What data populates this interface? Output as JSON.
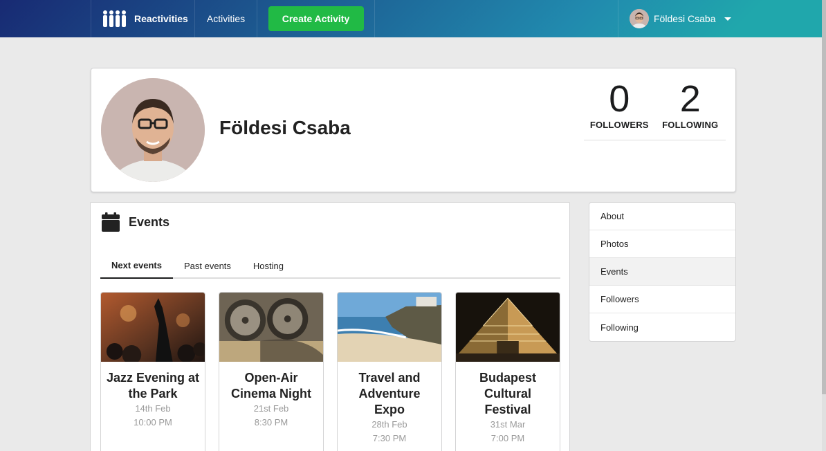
{
  "nav": {
    "brand": "Reactivities",
    "activities": "Activities",
    "create": "Create Activity",
    "user_name": "Földesi Csaba",
    "brand_icon": "people-group-icon",
    "caret_icon": "caret-down-icon"
  },
  "profile": {
    "name": "Földesi Csaba",
    "followers_count": "0",
    "followers_label": "FOLLOWERS",
    "following_count": "2",
    "following_label": "FOLLOWING"
  },
  "events": {
    "title": "Events",
    "icon": "calendar-icon",
    "tabs": [
      {
        "label": "Next events",
        "active": true
      },
      {
        "label": "Past events",
        "active": false
      },
      {
        "label": "Hosting",
        "active": false
      }
    ],
    "items": [
      {
        "title": "Jazz Evening at the Park",
        "date": "14th Feb",
        "time": "10:00 PM"
      },
      {
        "title": "Open-Air Cinema Night",
        "date": "21st Feb",
        "time": "8:30 PM"
      },
      {
        "title": "Travel and Adventure Expo",
        "date": "28th Feb",
        "time": "7:30 PM"
      },
      {
        "title": "Budapest Cultural Festival",
        "date": "31st Mar",
        "time": "7:00 PM"
      }
    ]
  },
  "side_menu": {
    "items": [
      {
        "label": "About",
        "active": false
      },
      {
        "label": "Photos",
        "active": false
      },
      {
        "label": "Events",
        "active": true
      },
      {
        "label": "Followers",
        "active": false
      },
      {
        "label": "Following",
        "active": false
      }
    ]
  },
  "colors": {
    "nav_start": "#182a73",
    "nav_end": "#20a7ac",
    "create_button": "#21ba45"
  }
}
